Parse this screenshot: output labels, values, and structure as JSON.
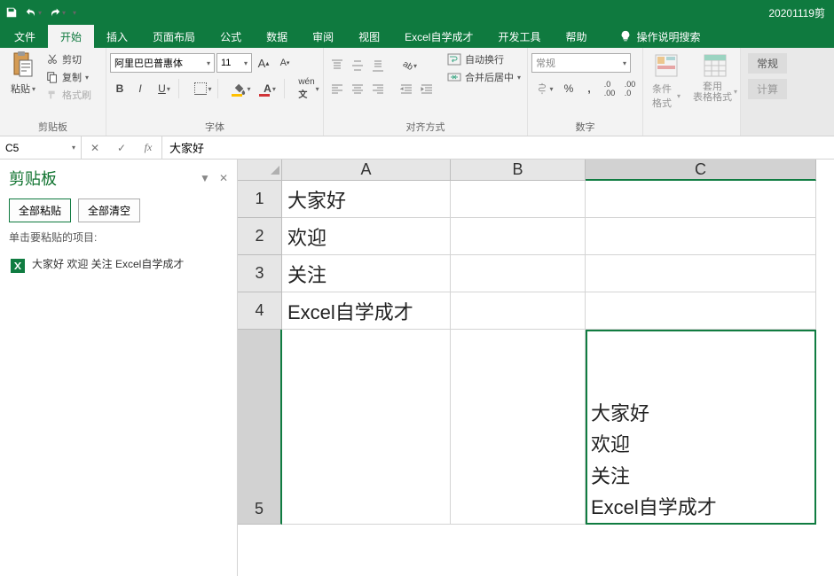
{
  "titlebar": {
    "doc_title": "20201119剪"
  },
  "tabs": {
    "file": "文件",
    "home": "开始",
    "insert": "插入",
    "pagelayout": "页面布局",
    "formulas": "公式",
    "data": "数据",
    "review": "审阅",
    "view": "视图",
    "addin": "Excel自学成才",
    "developer": "开发工具",
    "help": "帮助",
    "tellme": "操作说明搜索"
  },
  "ribbon": {
    "clipboard": {
      "paste": "粘贴",
      "cut": "剪切",
      "copy": "复制",
      "painter": "格式刷",
      "group": "剪贴板"
    },
    "font": {
      "name": "阿里巴巴普惠体",
      "size": "11",
      "group": "字体"
    },
    "align": {
      "wrap": "自动换行",
      "merge": "合并后居中",
      "group": "对齐方式"
    },
    "number": {
      "format": "常规",
      "group": "数字"
    },
    "styles": {
      "cond": "条件格式",
      "table": "套用\n表格格式",
      "group": ""
    },
    "view": {
      "normal": "常规",
      "calc": "计算"
    }
  },
  "namebox": "C5",
  "formula": "大家好",
  "pane": {
    "title": "剪贴板",
    "paste_all": "全部粘贴",
    "clear_all": "全部清空",
    "hint": "单击要粘贴的项目:",
    "clip1": "大家好 欢迎 关注 Excel自学成才"
  },
  "sheet": {
    "cols": [
      "A",
      "B",
      "C"
    ],
    "rows": [
      "1",
      "2",
      "3",
      "4",
      "5"
    ],
    "A1": "大家好",
    "A2": "欢迎",
    "A3": "关注",
    "A4": "Excel自学成才",
    "C5_lines": [
      "大家好",
      "欢迎",
      "关注",
      "Excel自学成才"
    ]
  }
}
